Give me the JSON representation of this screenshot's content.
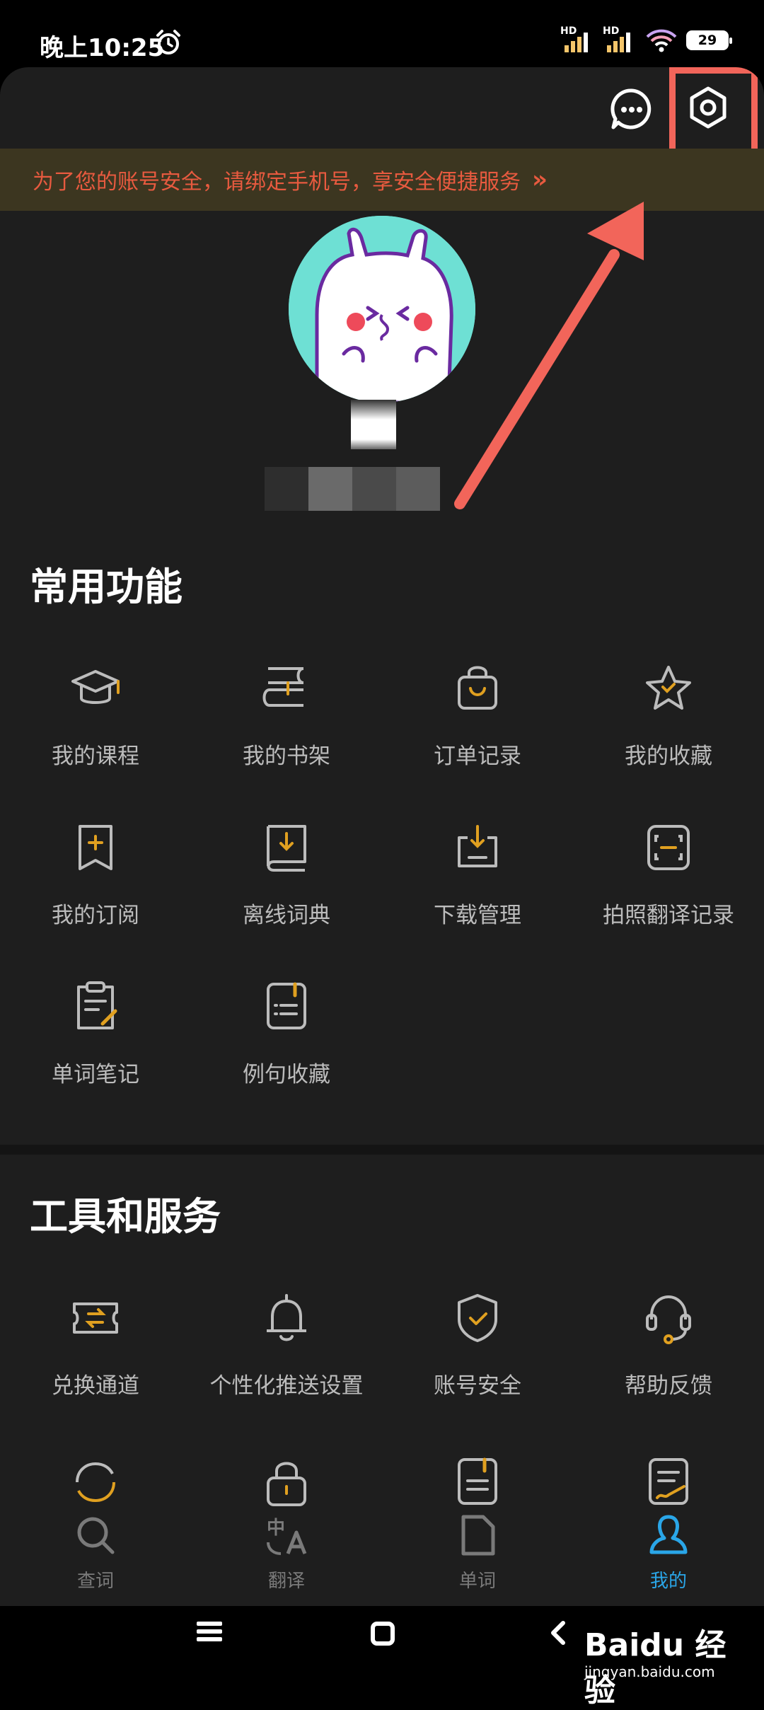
{
  "status_bar": {
    "time": "晚上10:25",
    "signal1_label": "HD",
    "signal2_label": "HD",
    "battery": "29"
  },
  "banner": {
    "text": "为了您的账号安全，请绑定手机号，享安全便捷服务",
    "arrow": "»"
  },
  "sections": {
    "common": {
      "title": "常用功能",
      "items": [
        {
          "label": "我的课程",
          "icon": "graduation-cap-icon"
        },
        {
          "label": "我的书架",
          "icon": "bookshelf-icon"
        },
        {
          "label": "订单记录",
          "icon": "shopping-bag-icon"
        },
        {
          "label": "我的收藏",
          "icon": "star-icon"
        },
        {
          "label": "我的订阅",
          "icon": "bookmark-plus-icon"
        },
        {
          "label": "离线词典",
          "icon": "book-download-icon"
        },
        {
          "label": "下载管理",
          "icon": "download-tray-icon"
        },
        {
          "label": "拍照翻译记录",
          "icon": "scan-frame-icon"
        },
        {
          "label": "单词笔记",
          "icon": "note-edit-icon"
        },
        {
          "label": "例句收藏",
          "icon": "list-doc-icon"
        }
      ]
    },
    "tools": {
      "title": "工具和服务",
      "items": [
        {
          "label": "兑换通道",
          "icon": "ticket-exchange-icon"
        },
        {
          "label": "个性化推送设置",
          "icon": "bell-icon"
        },
        {
          "label": "账号安全",
          "icon": "shield-check-icon"
        },
        {
          "label": "帮助反馈",
          "icon": "headset-icon"
        }
      ]
    }
  },
  "tabs": [
    {
      "label": "查词",
      "icon": "search-icon",
      "active": false
    },
    {
      "label": "翻译",
      "icon": "translate-icon",
      "active": false
    },
    {
      "label": "单词",
      "icon": "document-icon",
      "active": false
    },
    {
      "label": "我的",
      "icon": "person-icon",
      "active": true
    }
  ],
  "watermark": {
    "brand": "Baidu 经验",
    "url": "jingyan.baidu.com"
  },
  "colors": {
    "accent_gold": "#e0a020",
    "icon_gray": "#bcbcbc",
    "active_blue": "#2aa6e8",
    "banner_text": "#e85a3f",
    "highlight": "#f2655a"
  }
}
